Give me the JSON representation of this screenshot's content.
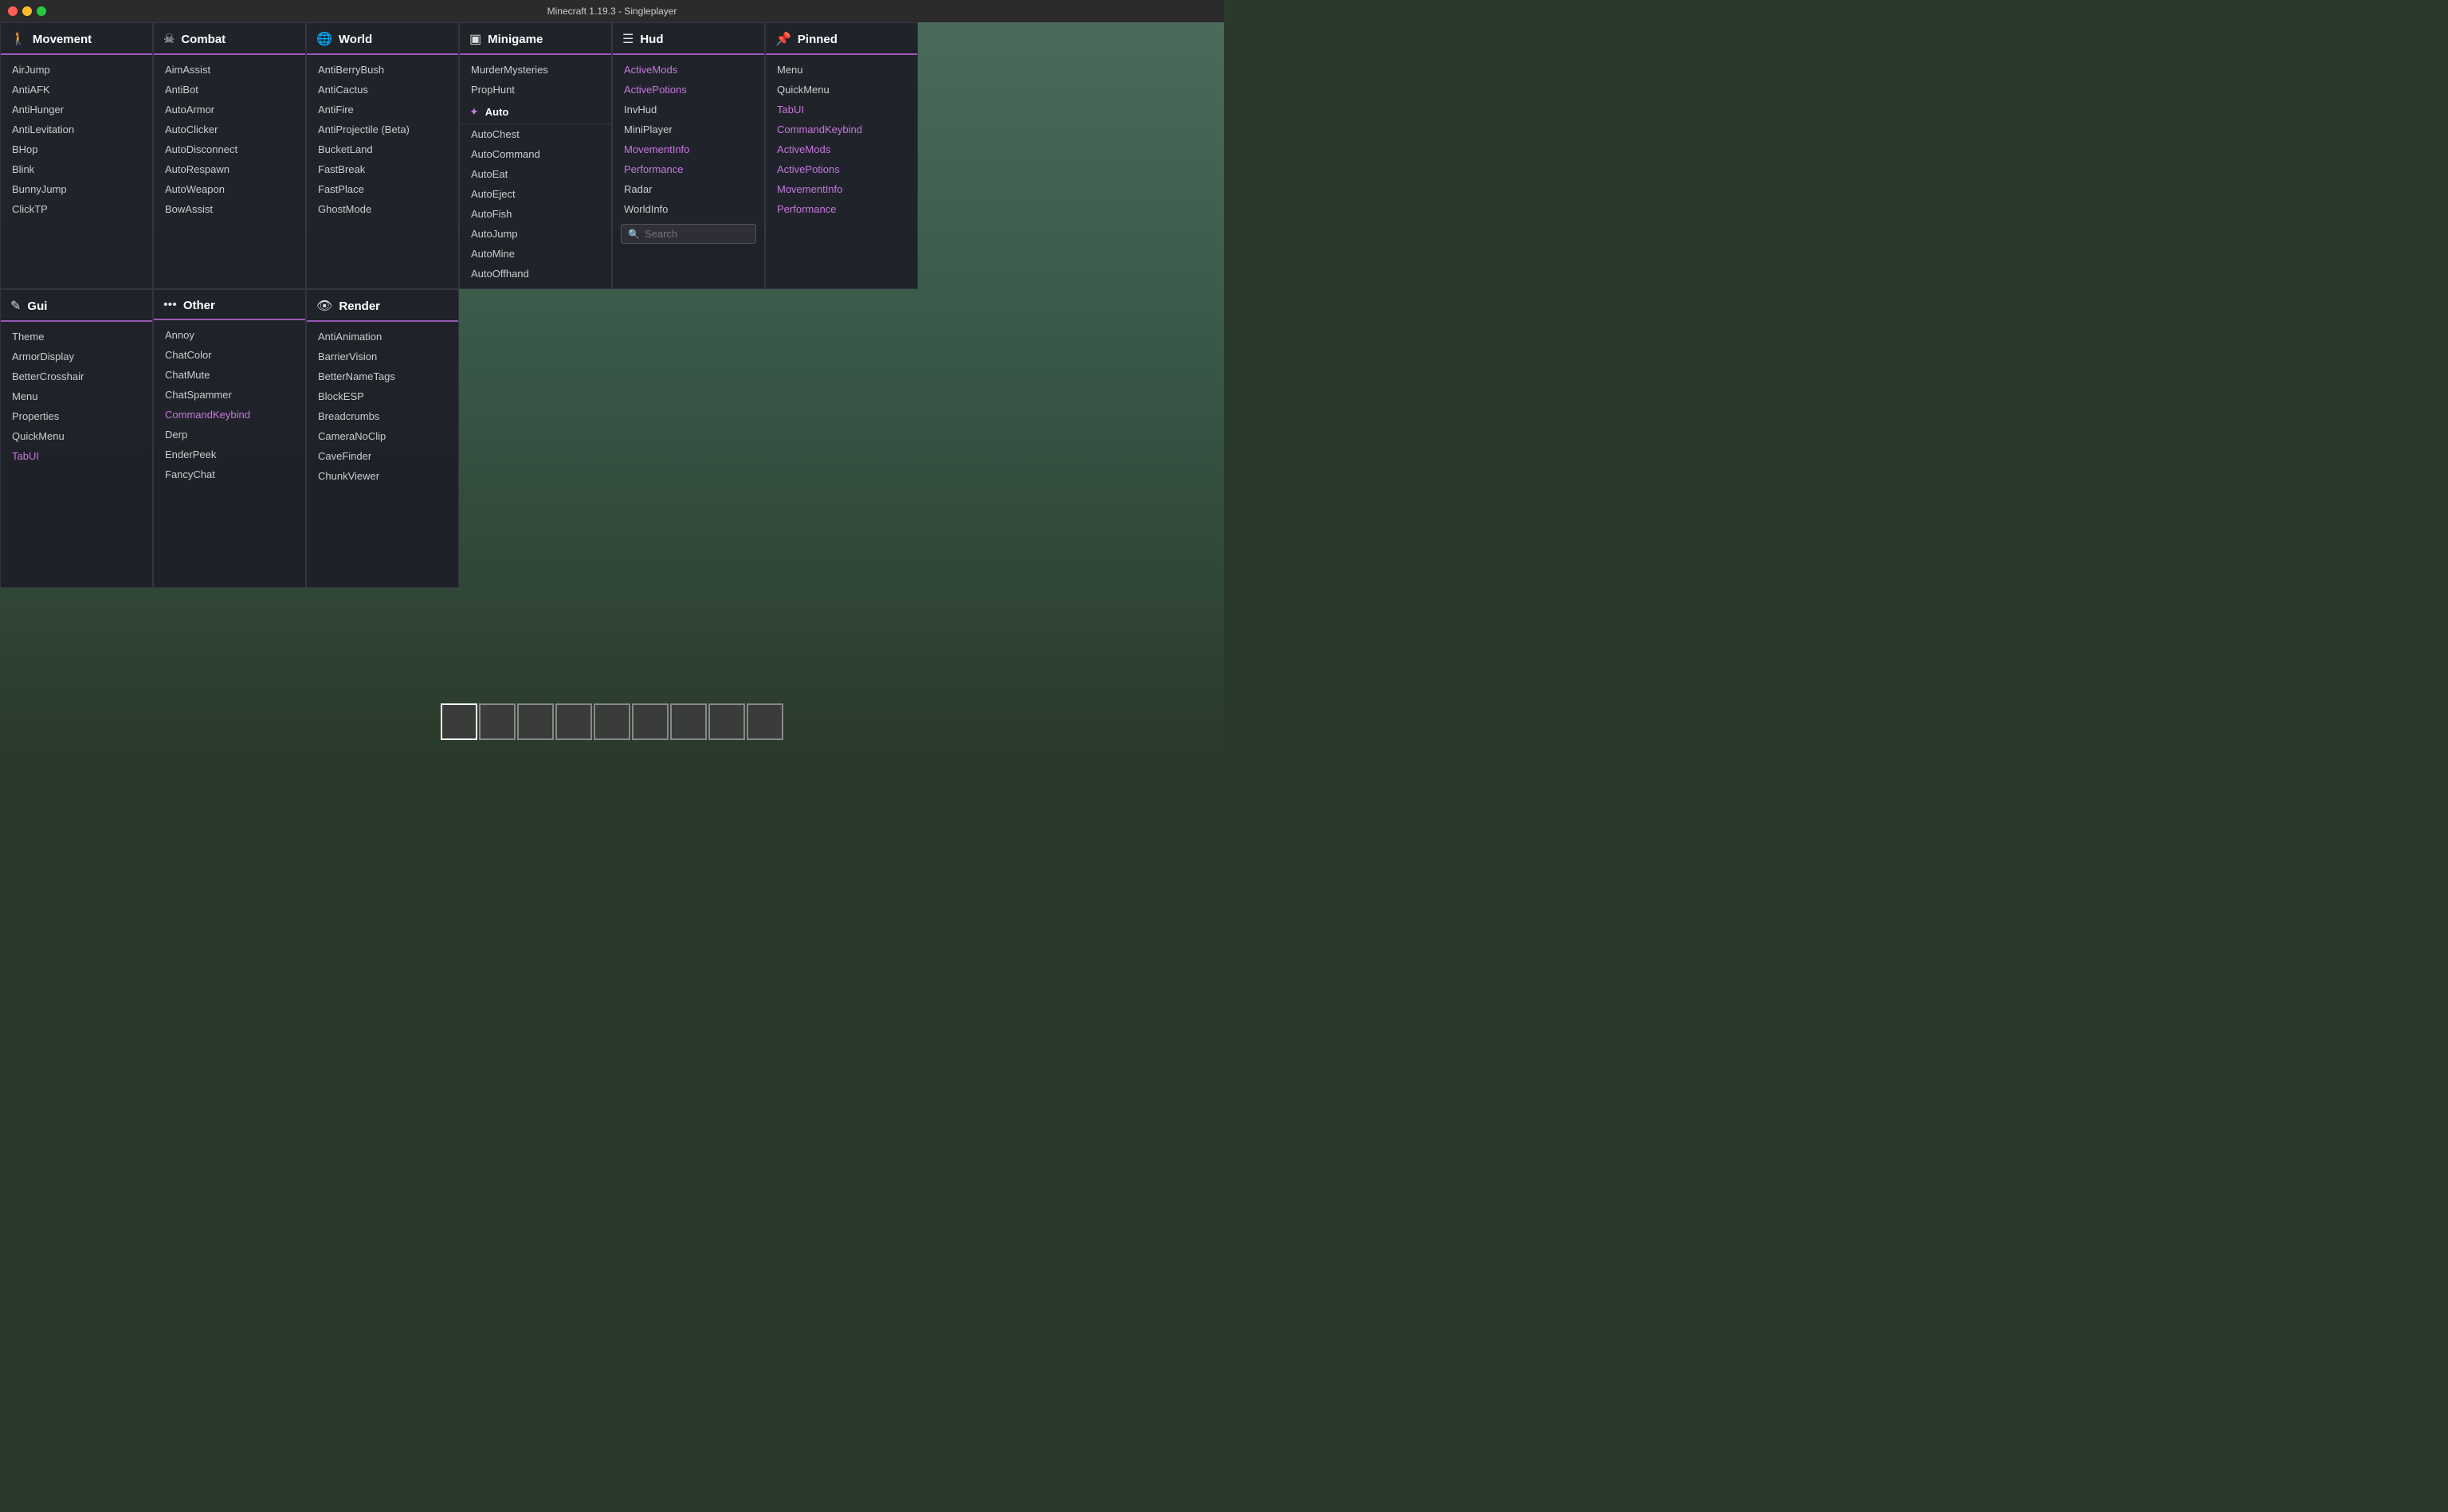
{
  "titlebar": {
    "title": "Minecraft 1.19.3 - Singleplayer",
    "buttons": [
      "close",
      "minimize",
      "maximize"
    ]
  },
  "panels": [
    {
      "id": "movement",
      "icon": "🚶",
      "title": "Movement",
      "items": [
        "AirJump",
        "AntiAFK",
        "AntiHunger",
        "AntiLevitation",
        "BHop",
        "Blink",
        "BunnyJump",
        "ClickTP"
      ],
      "highlighted": []
    },
    {
      "id": "combat",
      "icon": "☠",
      "title": "Combat",
      "items": [
        "AimAssist",
        "AntiBot",
        "AutoArmor",
        "AutoClicker",
        "AutoDisconnect",
        "AutoRespawn",
        "AutoWeapon",
        "BowAssist"
      ],
      "highlighted": []
    },
    {
      "id": "world",
      "icon": "🌐",
      "title": "World",
      "items": [
        "AntiBerryBush",
        "AntiCactus",
        "AntiFire",
        "AntiProjectile (Beta)",
        "BucketLand",
        "FastBreak",
        "FastPlace",
        "GhostMode"
      ],
      "highlighted": []
    },
    {
      "id": "minigame",
      "icon": "▣",
      "title": "Minigame",
      "top_items": [
        "MurderMysteries",
        "PropHunt"
      ],
      "sub_icon": "✦",
      "sub_title": "Auto",
      "sub_items": [
        "AutoChest",
        "AutoCommand",
        "AutoEat",
        "AutoEject",
        "AutoFish",
        "AutoJump",
        "AutoMine",
        "AutoOffhand"
      ],
      "highlighted": []
    },
    {
      "id": "hud",
      "icon": "☰",
      "title": "Hud",
      "items": [
        "ActiveMods",
        "ActivePotions",
        "InvHud",
        "MiniPlayer",
        "MovementInfo",
        "Performance",
        "Radar",
        "WorldInfo"
      ],
      "highlighted": [
        "ActiveMods",
        "ActivePotions",
        "MovementInfo",
        "Performance"
      ],
      "search_placeholder": "Search"
    },
    {
      "id": "pinned",
      "icon": "📌",
      "title": "Pinned",
      "items": [
        "Menu",
        "QuickMenu",
        "TabUI",
        "CommandKeybind",
        "ActiveMods",
        "ActivePotions",
        "MovementInfo",
        "Performance"
      ],
      "highlighted": [
        "TabUI",
        "CommandKeybind",
        "ActiveMods",
        "ActivePotions",
        "MovementInfo",
        "Performance"
      ]
    }
  ],
  "panels_row2": [
    {
      "id": "gui",
      "icon": "✎",
      "title": "Gui",
      "items": [
        "Theme",
        "ArmorDisplay",
        "BetterCrosshair",
        "Menu",
        "Properties",
        "QuickMenu",
        "TabUI"
      ],
      "highlighted": [
        "TabUI"
      ]
    },
    {
      "id": "other",
      "icon": "•••",
      "title": "Other",
      "items": [
        "Annoy",
        "ChatColor",
        "ChatMute",
        "ChatSpammer",
        "CommandKeybind",
        "Derp",
        "EnderPeek",
        "FancyChat"
      ],
      "highlighted": [
        "CommandKeybind"
      ]
    },
    {
      "id": "render",
      "icon": "👁",
      "title": "Render",
      "items": [
        "AntiAnimation",
        "BarrierVision",
        "BetterNameTags",
        "BlockESP",
        "Breadcrumbs",
        "CameraNoClip",
        "CaveFinder",
        "ChunkViewer"
      ],
      "highlighted": []
    }
  ],
  "hotbar": {
    "slots": 9,
    "active_slot": 0
  }
}
